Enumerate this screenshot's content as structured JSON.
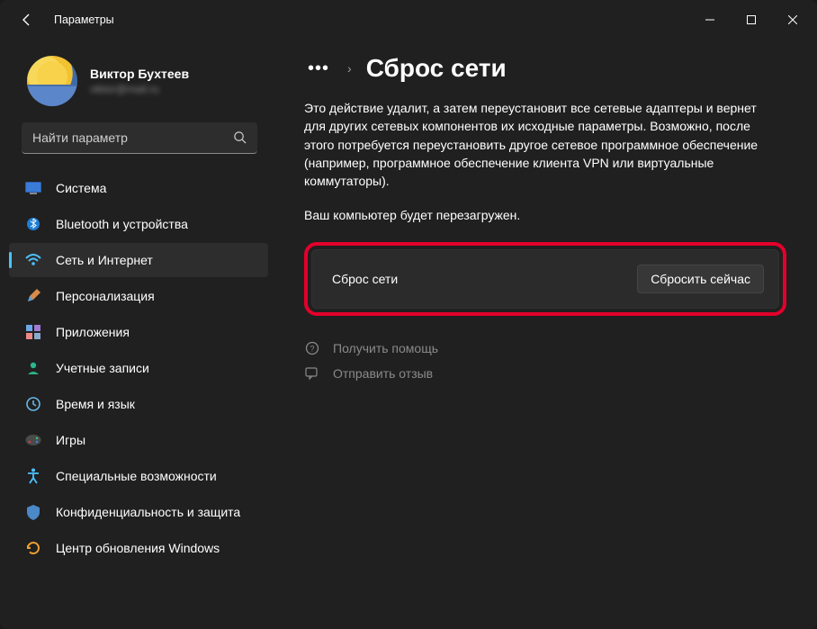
{
  "titlebar": {
    "title": "Параметры"
  },
  "profile": {
    "name": "Виктор Бухтеев",
    "email": "viktor@mail.ru"
  },
  "search": {
    "placeholder": "Найти параметр"
  },
  "sidebar": {
    "items": [
      {
        "label": "Система",
        "icon": "system"
      },
      {
        "label": "Bluetooth и устройства",
        "icon": "bluetooth"
      },
      {
        "label": "Сеть и Интернет",
        "icon": "network",
        "active": true
      },
      {
        "label": "Персонализация",
        "icon": "personalization"
      },
      {
        "label": "Приложения",
        "icon": "apps"
      },
      {
        "label": "Учетные записи",
        "icon": "accounts"
      },
      {
        "label": "Время и язык",
        "icon": "time"
      },
      {
        "label": "Игры",
        "icon": "gaming"
      },
      {
        "label": "Специальные возможности",
        "icon": "accessibility"
      },
      {
        "label": "Конфиденциальность и защита",
        "icon": "privacy"
      },
      {
        "label": "Центр обновления Windows",
        "icon": "update"
      }
    ]
  },
  "main": {
    "page_title": "Сброс сети",
    "description": "Это действие удалит, а затем переустановит все сетевые адаптеры и вернет для других сетевых компонентов их исходные параметры. Возможно, после этого потребуется переустановить другое сетевое программное обеспечение (например, программное обеспечение клиента VPN или виртуальные коммутаторы).",
    "reboot_note": "Ваш компьютер будет перезагружен.",
    "card": {
      "label": "Сброс сети",
      "button": "Сбросить сейчас"
    },
    "help_link": "Получить помощь",
    "feedback_link": "Отправить отзыв"
  }
}
